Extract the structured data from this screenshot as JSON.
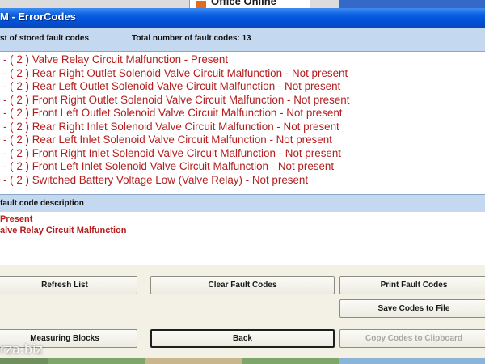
{
  "window": {
    "title": "M - ErrorCodes"
  },
  "background": {
    "office_label": "Office Online"
  },
  "header": {
    "stored_codes_label": "st of stored fault codes",
    "total_label": "Total number of fault codes:  13"
  },
  "fault_codes": [
    "- ( 2 )  Valve Relay Circuit Malfunction - Present",
    "- ( 2 )  Rear Right Outlet Solenoid Valve Circuit Malfunction - Not present",
    "- ( 2 )  Rear Left Outlet Solenoid Valve Circuit Malfunction - Not present",
    "- ( 2 )  Front Right Outlet Solenoid Valve Circuit Malfunction - Not present",
    "- ( 2 )  Front Left Outlet Solenoid Valve Circuit Malfunction - Not present",
    "- ( 2 )  Rear Right Inlet Solenoid Valve Circuit Malfunction - Not present",
    "- ( 2 )  Rear Left Inlet Solenoid Valve Circuit Malfunction - Not present",
    "- ( 2 )  Front Right Inlet Solenoid Valve Circuit Malfunction - Not present",
    "- ( 2 )  Front Left Inlet Solenoid Valve Circuit Malfunction - Not present",
    "- ( 2 )  Switched Battery Voltage Low (Valve Relay) - Not present"
  ],
  "description": {
    "header_label": "fault code description",
    "line1": "Present",
    "line2": "alve Relay Circuit Malfunction"
  },
  "buttons": {
    "refresh": "Refresh List",
    "clear": "Clear Fault Codes",
    "print": "Print Fault Codes",
    "save": "Save Codes to File",
    "measuring": "Measuring Blocks",
    "back": "Back",
    "copy": "Copy Codes to Clipboard"
  },
  "watermark": "rza.biz",
  "colors": {
    "title_bar": "#0050d8",
    "panel_header": "#c4d8f0",
    "fault_text": "#b41e1e",
    "dialog_background": "#f3f1e6"
  }
}
